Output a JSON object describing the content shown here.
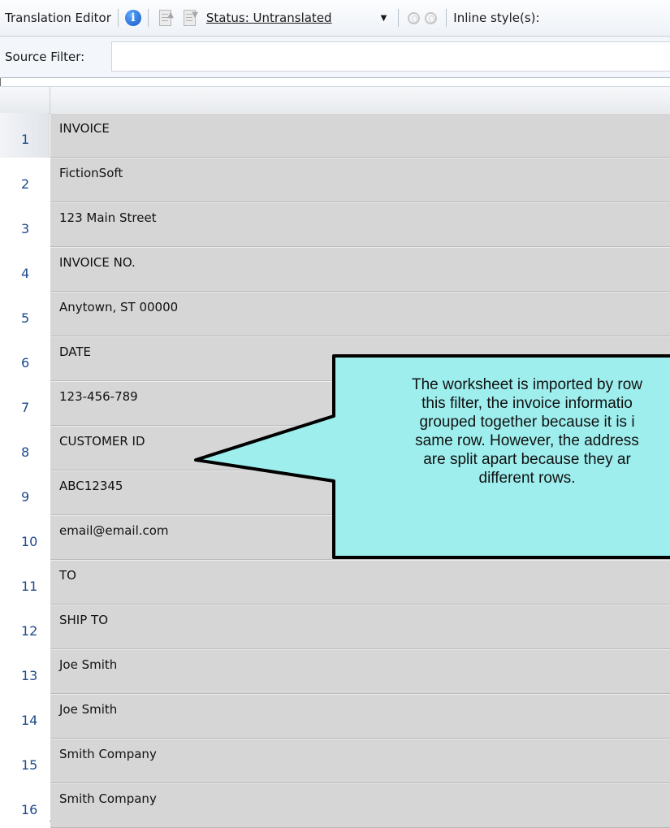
{
  "toolbar": {
    "title": "Translation Editor",
    "info_icon": "info-icon",
    "status_label": "Status: Untranslated",
    "inline_styles_label": "Inline style(s):"
  },
  "filter": {
    "label": "Source Filter:",
    "value": ""
  },
  "rows": [
    {
      "num": "1",
      "text": "INVOICE"
    },
    {
      "num": "2",
      "text": "FictionSoft"
    },
    {
      "num": "3",
      "text": "123 Main Street"
    },
    {
      "num": "4",
      "text": "INVOICE NO."
    },
    {
      "num": "5",
      "text": "Anytown, ST 00000"
    },
    {
      "num": "6",
      "text": "DATE"
    },
    {
      "num": "7",
      "text": "123-456-789"
    },
    {
      "num": "8",
      "text": "CUSTOMER ID"
    },
    {
      "num": "9",
      "text": "ABC12345"
    },
    {
      "num": "10",
      "text": "email@email.com"
    },
    {
      "num": "11",
      "text": "TO"
    },
    {
      "num": "12",
      "text": "SHIP TO"
    },
    {
      "num": "13",
      "text": "Joe Smith"
    },
    {
      "num": "14",
      "text": "Joe Smith"
    },
    {
      "num": "15",
      "text": "Smith Company"
    },
    {
      "num": "16",
      "text": "Smith Company"
    }
  ],
  "callout": {
    "lines": [
      "The worksheet is imported by row",
      "this filter, the invoice informatio",
      "grouped together because it is i",
      "same row. However, the address",
      "are split apart because they ar",
      "different rows."
    ],
    "fill": "#9eeeee"
  }
}
